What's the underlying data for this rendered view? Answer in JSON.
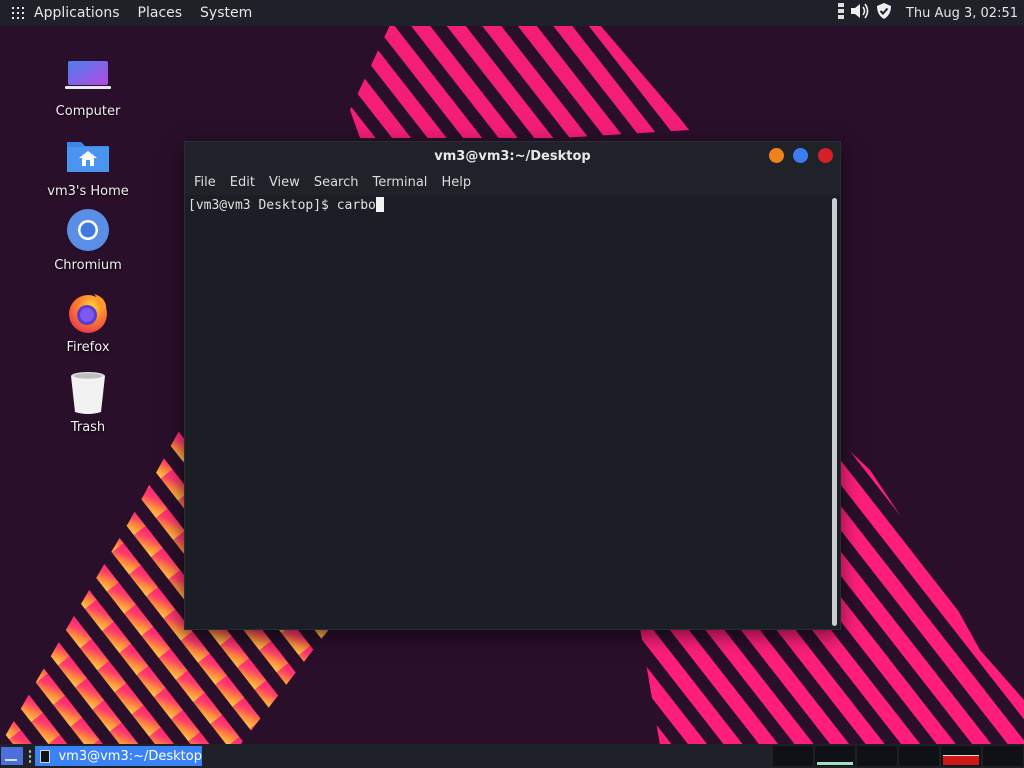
{
  "top_panel": {
    "menus": [
      "Applications",
      "Places",
      "System"
    ],
    "clock": "Thu Aug  3, 02:51",
    "tray_icons": [
      "network-icon",
      "volume-icon",
      "shield-icon"
    ]
  },
  "desktop_icons": [
    {
      "label": "Computer",
      "icon": "computer-icon"
    },
    {
      "label": "vm3's Home",
      "icon": "home-folder-icon"
    },
    {
      "label": "Chromium",
      "icon": "chromium-icon"
    },
    {
      "label": "Firefox",
      "icon": "firefox-icon"
    },
    {
      "label": "Trash",
      "icon": "trash-icon"
    }
  ],
  "terminal": {
    "title": "vm3@vm3:~/Desktop",
    "menu": [
      "File",
      "Edit",
      "View",
      "Search",
      "Terminal",
      "Help"
    ],
    "prompt": "[vm3@vm3 Desktop]$ ",
    "input": "carbo",
    "window_buttons": {
      "minimize": "#f0821e",
      "maximize": "#3d7cf0",
      "close": "#d81f26"
    }
  },
  "taskbar": {
    "task_label": "vm3@vm3:~/Desktop",
    "workspaces": 6
  },
  "colors": {
    "panel": "#1e2127",
    "accent": "#3b82f6",
    "wallpaper_bg": "#2a0f2b",
    "stripe_pink": "#ff1f7a",
    "stripe_orange": "#ff7a3d",
    "stripe_yellow": "#ffb54a"
  }
}
